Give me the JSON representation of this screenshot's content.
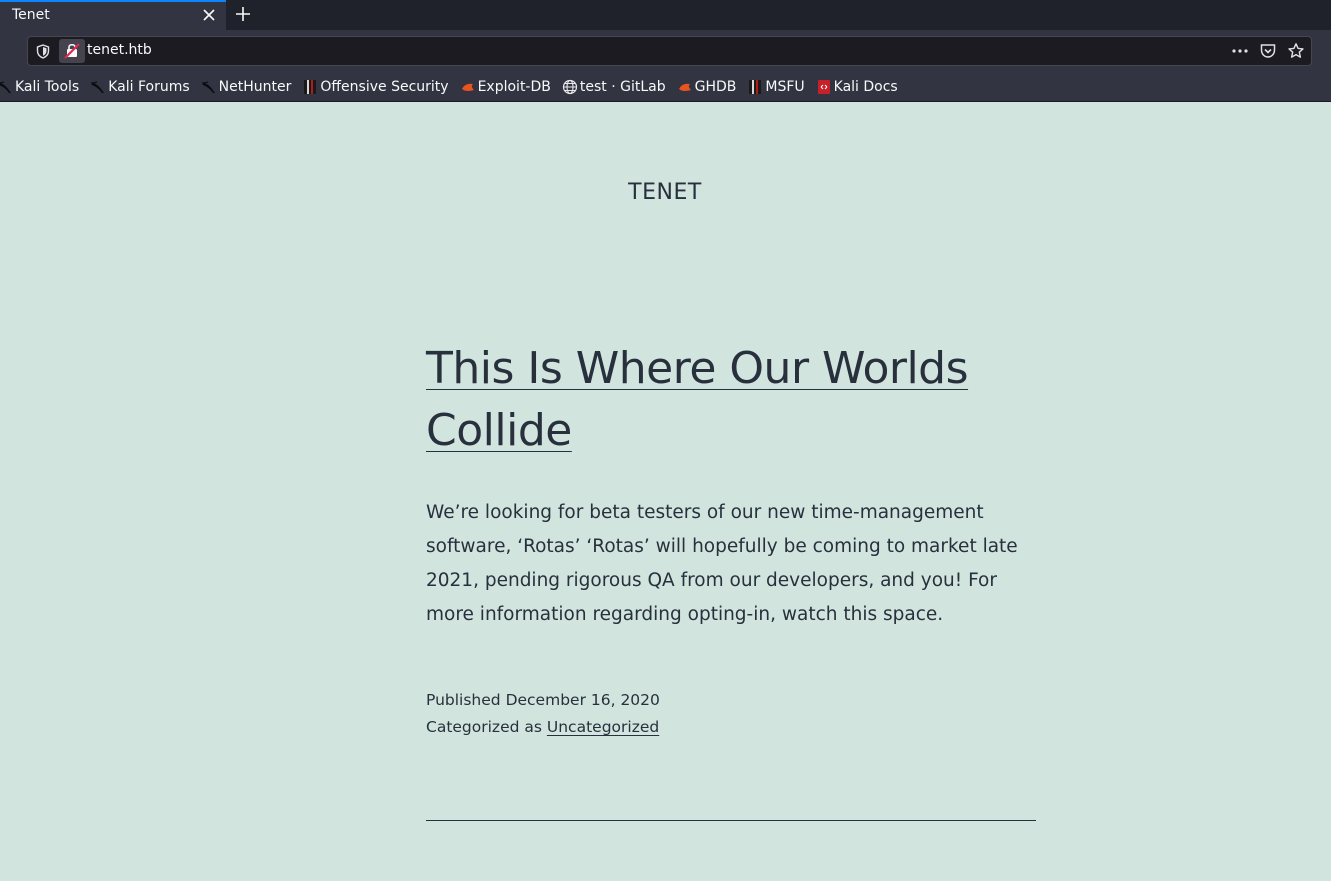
{
  "browser": {
    "tab": {
      "title": "Tenet"
    },
    "url": "tenet.htb",
    "bookmarks": [
      {
        "label": "Kali Tools",
        "icon": "kali-dragon-icon"
      },
      {
        "label": "Kali Forums",
        "icon": "kali-dragon-icon"
      },
      {
        "label": "NetHunter",
        "icon": "kali-dragon-icon"
      },
      {
        "label": "Offensive Security",
        "icon": "offsec-icon"
      },
      {
        "label": "Exploit-DB",
        "icon": "exploit-db-icon"
      },
      {
        "label": "test · GitLab",
        "icon": "globe-icon"
      },
      {
        "label": "GHDB",
        "icon": "exploit-db-icon"
      },
      {
        "label": "MSFU",
        "icon": "offsec-icon"
      },
      {
        "label": "Kali Docs",
        "icon": "kali-docs-icon"
      }
    ]
  },
  "site": {
    "title": "TENET"
  },
  "post": {
    "title": "This Is Where Our Worlds Collide",
    "content": "We’re looking for beta testers of our new time-management software, ‘Rotas’ ‘Rotas’ will hopefully be coming to market late 2021, pending rigorous QA from our developers, and you! For more information regarding opting-in, watch this space.",
    "published_label": "Published",
    "published_date": "December 16, 2020",
    "category_label": "Categorized as",
    "category": "Uncategorized"
  },
  "colors": {
    "page_background": "#d1e4dd",
    "text": "#28303d",
    "chrome_dark": "#1f222b",
    "chrome": "#323541",
    "accent": "#0a84ff"
  }
}
